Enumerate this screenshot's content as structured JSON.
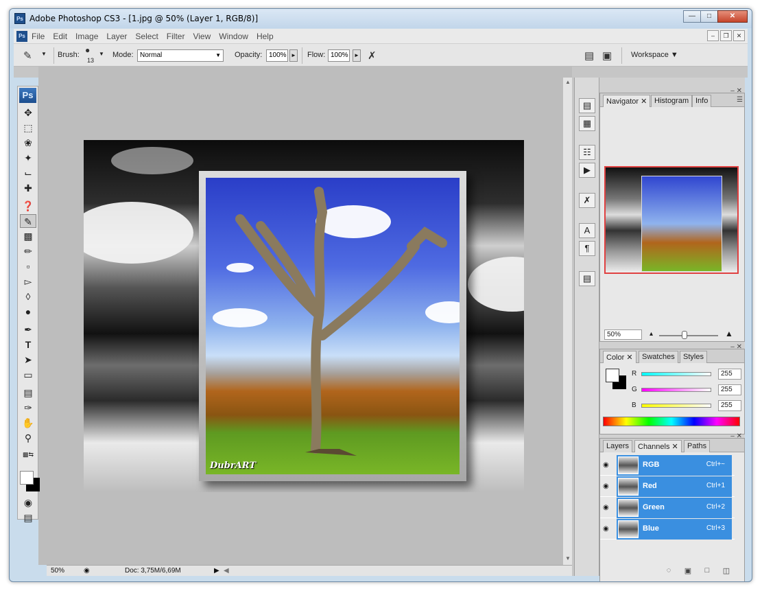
{
  "app": {
    "title": "Adobe Photoshop CS3 - [1.jpg @ 50% (Layer 1, RGB/8)]",
    "icon": "Ps"
  },
  "menu": {
    "items": [
      "File",
      "Edit",
      "Image",
      "Layer",
      "Select",
      "Filter",
      "View",
      "Window",
      "Help"
    ]
  },
  "options": {
    "brush_label": "Brush:",
    "brush_size": "13",
    "mode_label": "Mode:",
    "mode_value": "Normal",
    "opacity_label": "Opacity:",
    "opacity_value": "100%",
    "flow_label": "Flow:",
    "flow_value": "100%",
    "workspace_label": "Workspace"
  },
  "toolbox": {
    "logo": "Ps"
  },
  "status": {
    "zoom": "50%",
    "doc_info": "Doc: 3,75M/6,69M"
  },
  "document": {
    "watermark": "DubrART"
  },
  "navigator": {
    "tabs": [
      "Navigator",
      "Histogram",
      "Info"
    ],
    "zoom": "50%"
  },
  "color": {
    "tabs": [
      "Color",
      "Swatches",
      "Styles"
    ],
    "r_label": "R",
    "g_label": "G",
    "b_label": "B",
    "r_value": "255",
    "g_value": "255",
    "b_value": "255"
  },
  "channels": {
    "tabs": [
      "Layers",
      "Channels",
      "Paths"
    ],
    "items": [
      {
        "name": "RGB",
        "shortcut": "Ctrl+~"
      },
      {
        "name": "Red",
        "shortcut": "Ctrl+1"
      },
      {
        "name": "Green",
        "shortcut": "Ctrl+2"
      },
      {
        "name": "Blue",
        "shortcut": "Ctrl+3"
      }
    ]
  },
  "colors": {
    "selection_blue": "#3a8fe0",
    "close_red": "#c6452b"
  }
}
